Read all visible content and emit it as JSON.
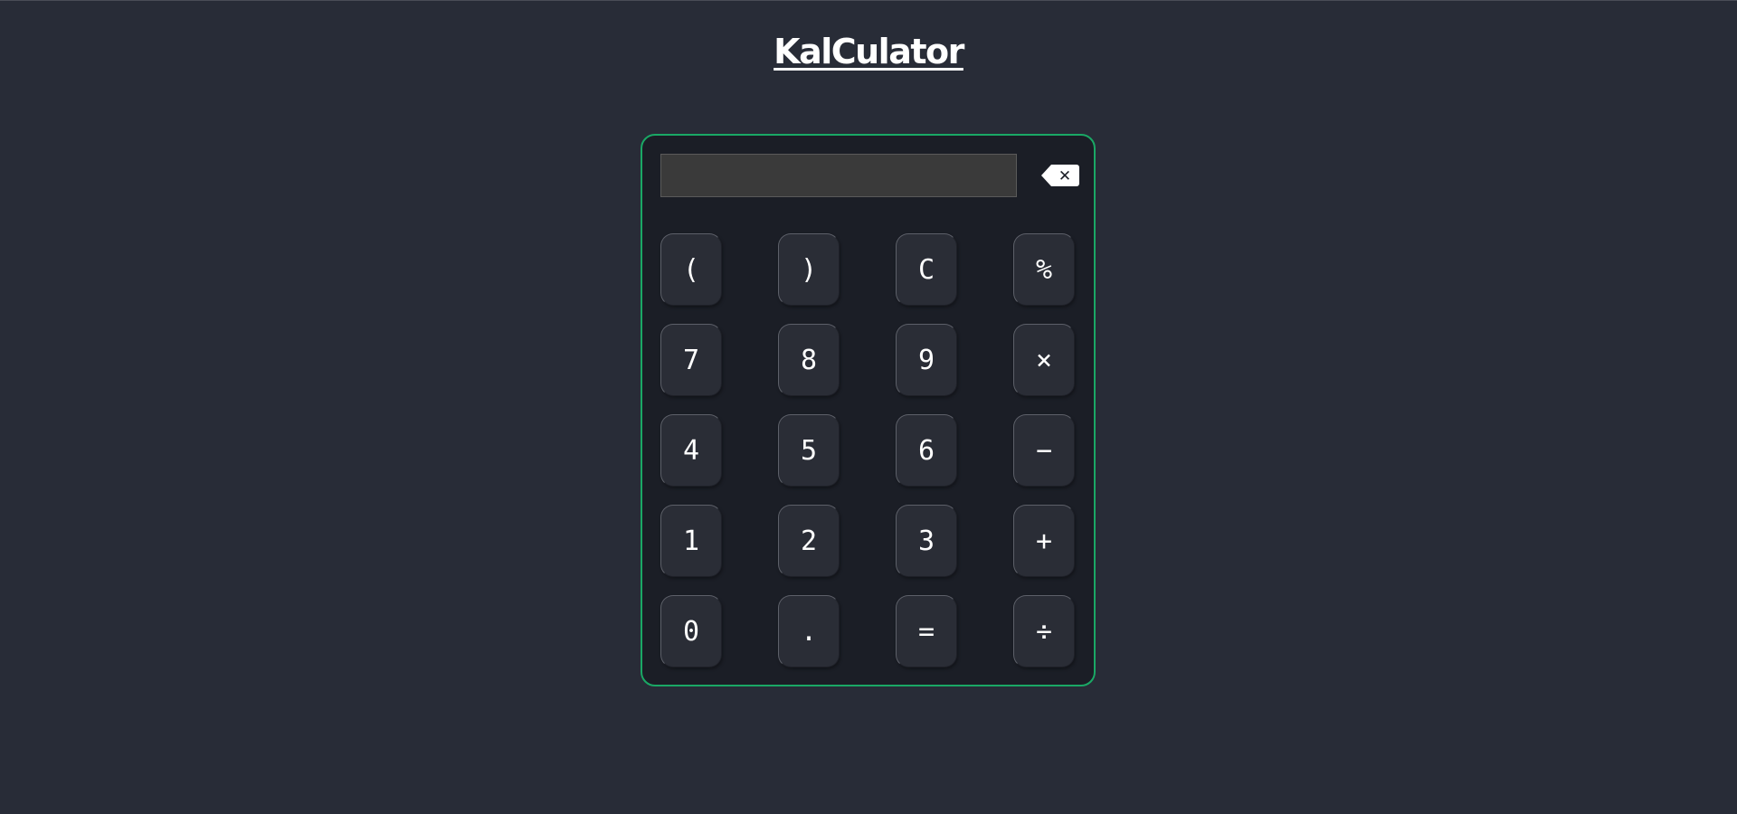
{
  "app": {
    "title": "KalCulator"
  },
  "display": {
    "value": ""
  },
  "backspace": {
    "icon": "backspace-icon",
    "symbol": "✕"
  },
  "keys": [
    {
      "label": "(",
      "name": "key-open-paren"
    },
    {
      "label": ")",
      "name": "key-close-paren"
    },
    {
      "label": "C",
      "name": "key-clear"
    },
    {
      "label": "%",
      "name": "key-percent"
    },
    {
      "label": "7",
      "name": "key-7"
    },
    {
      "label": "8",
      "name": "key-8"
    },
    {
      "label": "9",
      "name": "key-9"
    },
    {
      "label": "×",
      "name": "key-multiply"
    },
    {
      "label": "4",
      "name": "key-4"
    },
    {
      "label": "5",
      "name": "key-5"
    },
    {
      "label": "6",
      "name": "key-6"
    },
    {
      "label": "−",
      "name": "key-subtract"
    },
    {
      "label": "1",
      "name": "key-1"
    },
    {
      "label": "2",
      "name": "key-2"
    },
    {
      "label": "3",
      "name": "key-3"
    },
    {
      "label": "+",
      "name": "key-add"
    },
    {
      "label": "0",
      "name": "key-0"
    },
    {
      "label": ".",
      "name": "key-decimal"
    },
    {
      "label": "=",
      "name": "key-equals"
    },
    {
      "label": "÷",
      "name": "key-divide"
    }
  ],
  "colors": {
    "page_background": "#282c37",
    "calculator_background": "#1b1e26",
    "calculator_border": "#1aa865",
    "key_background": "#2a2d36",
    "display_background": "#3a3a3a",
    "text": "#ffffff"
  }
}
